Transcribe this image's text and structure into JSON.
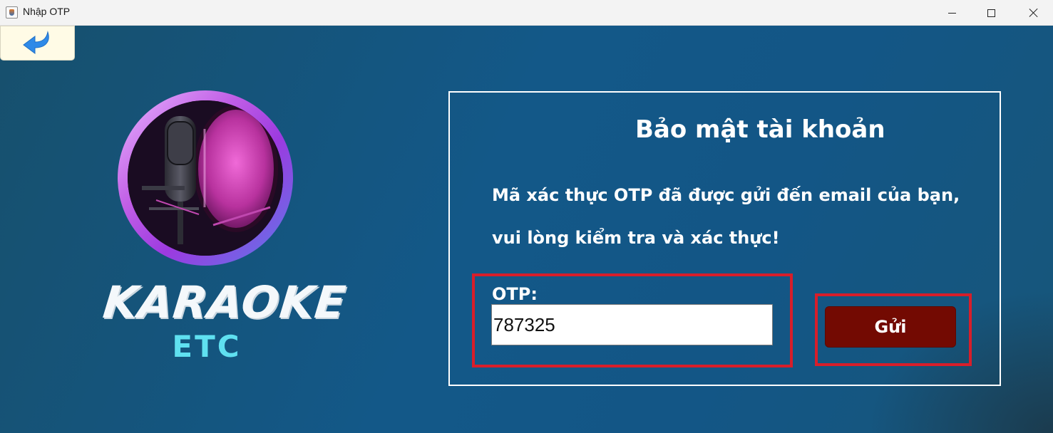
{
  "window": {
    "title": "Nhập OTP",
    "app_icon": "java-cup-icon",
    "controls": [
      "minimize-icon",
      "maximize-icon",
      "close-icon"
    ]
  },
  "back_button": {
    "icon": "back-arrow-icon"
  },
  "logo": {
    "line1": "KARAOKE",
    "line2": "ETC",
    "image": "microphone-pop-filter"
  },
  "panel": {
    "title": "Bảo mật tài khoản",
    "message_line1": "Mã xác thực OTP đã được gửi đến email của bạn,",
    "message_line2": "vui lòng kiểm tra và xác thực!",
    "otp_label": "OTP:",
    "otp_value": "787325",
    "send_label": "Gửi"
  },
  "colors": {
    "background": "#135888",
    "send_button": "#730a02",
    "highlight_box": "#d81e2a",
    "logo_accent": "#5fe0f0"
  }
}
